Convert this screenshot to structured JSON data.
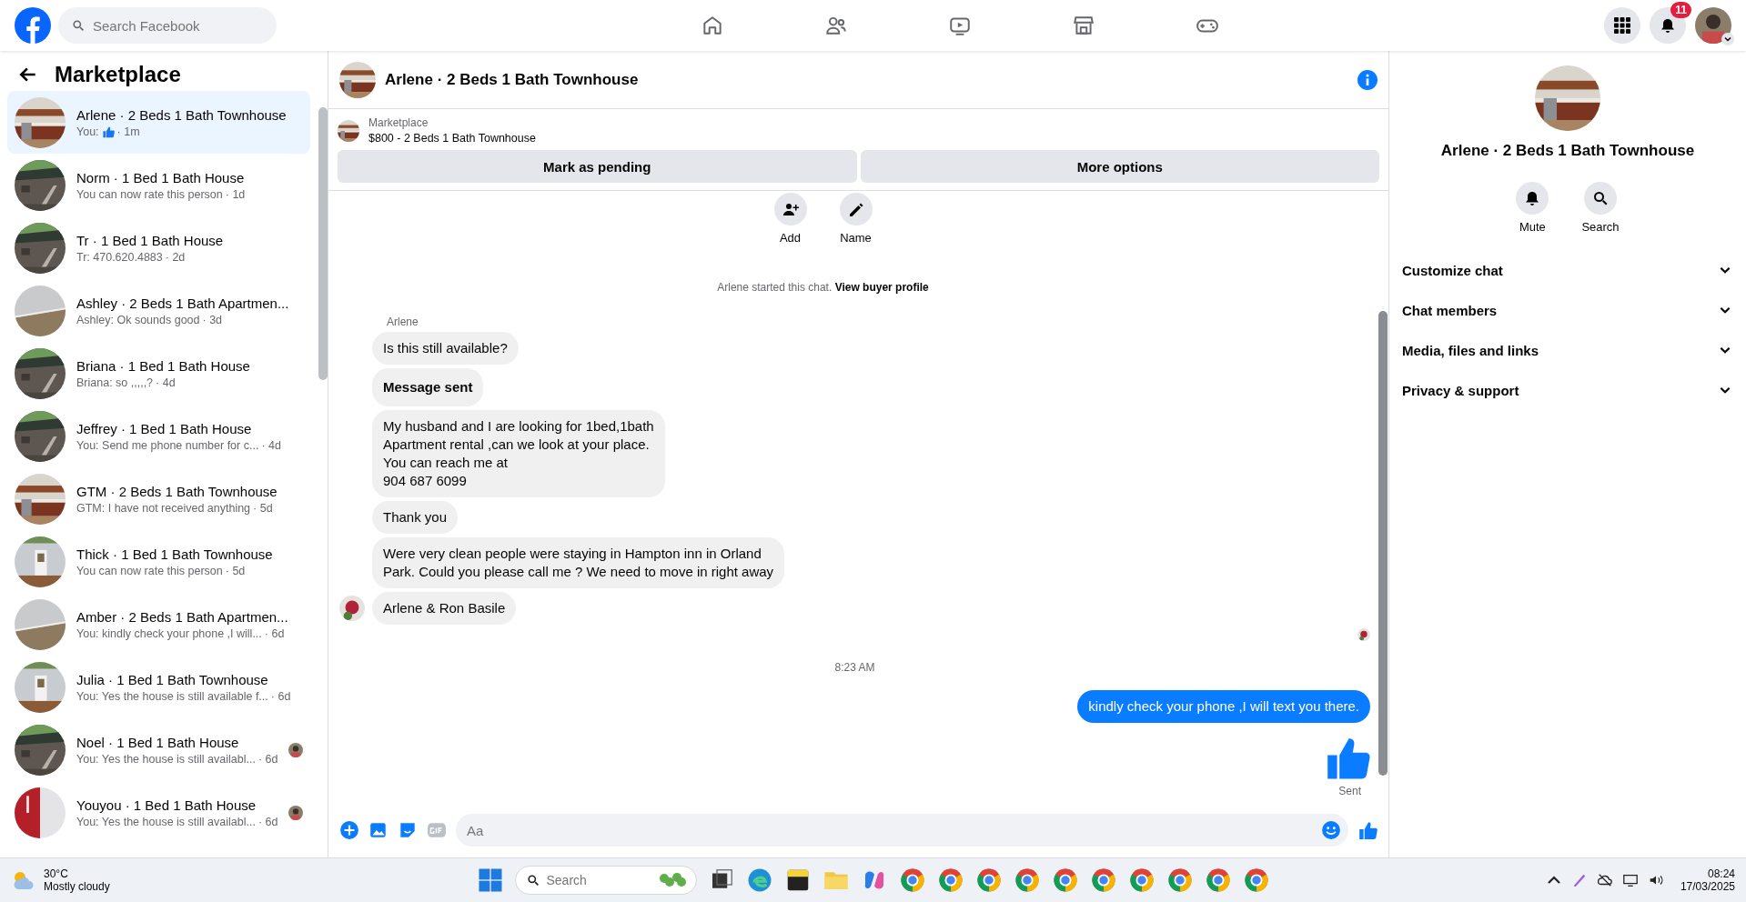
{
  "topbar": {
    "search": {
      "placeholder": "Search Facebook"
    },
    "notifications_badge": "11"
  },
  "sidebar": {
    "title": "Marketplace",
    "items": [
      {
        "title": "Arlene · 2 Beds 1 Bath Townhouse",
        "preview": "You:",
        "like_icon": true,
        "time": "· 1m",
        "seen_avatar": false,
        "selected": true
      },
      {
        "title": "Norm · 1 Bed 1 Bath House",
        "preview": "You can now rate this person",
        "like_icon": false,
        "time": "· 1d",
        "seen_avatar": false,
        "selected": false
      },
      {
        "title": "Tr · 1 Bed 1 Bath House",
        "preview": "Tr: 470.620.4883",
        "like_icon": false,
        "time": "· 2d",
        "seen_avatar": false,
        "selected": false
      },
      {
        "title": "Ashley · 2 Beds 1 Bath Apartmen...",
        "preview": "Ashley: Ok sounds good",
        "like_icon": false,
        "time": "· 3d",
        "seen_avatar": false,
        "selected": false
      },
      {
        "title": "Briana · 1 Bed 1 Bath House",
        "preview": "Briana: so ,,,,,?",
        "like_icon": false,
        "time": "· 4d",
        "seen_avatar": false,
        "selected": false
      },
      {
        "title": "Jeffrey · 1 Bed 1 Bath House",
        "preview": "You: Send me phone number for c...",
        "like_icon": false,
        "time": "· 4d",
        "seen_avatar": false,
        "selected": false
      },
      {
        "title": "GTM · 2 Beds 1 Bath Townhouse",
        "preview": "GTM: I have not received anything",
        "like_icon": false,
        "time": "· 5d",
        "seen_avatar": false,
        "selected": false
      },
      {
        "title": "Thick · 1 Bed 1 Bath Townhouse",
        "preview": "You can now rate this person",
        "like_icon": false,
        "time": "· 5d",
        "seen_avatar": false,
        "selected": false
      },
      {
        "title": "Amber · 2 Beds 1 Bath Apartmen...",
        "preview": "You: kindly check your phone ,I will...",
        "like_icon": false,
        "time": "· 6d",
        "seen_avatar": false,
        "selected": false
      },
      {
        "title": "Julia · 1 Bed 1 Bath Townhouse",
        "preview": "You: Yes the house is still available f...",
        "like_icon": false,
        "time": "· 6d",
        "seen_avatar": false,
        "selected": false
      },
      {
        "title": "Noel · 1 Bed 1 Bath House",
        "preview": "You: Yes the house is still availabl...",
        "like_icon": false,
        "time": "· 6d",
        "seen_avatar": true,
        "selected": false
      },
      {
        "title": "Youyou · 1 Bed 1 Bath House",
        "preview": "You: Yes the house is still availabl...",
        "like_icon": false,
        "time": "· 6d",
        "seen_avatar": true,
        "selected": false
      }
    ]
  },
  "chat": {
    "title": "Arlene · 2 Beds 1 Bath Townhouse",
    "listing": {
      "source": "Marketplace",
      "summary": "$800 - 2 Beds 1 Bath Townhouse"
    },
    "buttons": [
      "Mark as pending",
      "More options"
    ],
    "actions": [
      {
        "label": "Add",
        "kind": "add-person"
      },
      {
        "label": "Name",
        "kind": "pencil"
      }
    ],
    "started": {
      "text": "Arlene started this chat.",
      "link": "View buyer profile"
    },
    "sender": "Arlene",
    "incoming": [
      {
        "text": "Is this still available?",
        "bold": false,
        "avatar": false
      },
      {
        "text": "Message sent",
        "bold": true,
        "avatar": false
      },
      {
        "text": "My husband and I are looking for 1bed,1bath\nApartment rental ,can we look at your place.\nYou can reach me at\n904 687 6099",
        "bold": false,
        "avatar": false
      },
      {
        "text": "Thank you",
        "bold": false,
        "avatar": false
      },
      {
        "text": "Were very clean people were staying in Hampton inn in Orland\nPark. Could you please call me ? We need to move in right away",
        "bold": false,
        "avatar": false
      },
      {
        "text": "Arlene & Ron Basile",
        "bold": false,
        "avatar": true
      }
    ],
    "timestamp": "8:23 AM",
    "outgoing": [
      {
        "text": "kindly check your phone ,I will text you there."
      }
    ],
    "like": {
      "status": "Sent"
    },
    "composer": {
      "placeholder": "Aa"
    }
  },
  "info": {
    "title": "Arlene · 2 Beds 1 Bath Townhouse",
    "actions": [
      {
        "label": "Mute",
        "kind": "bell"
      },
      {
        "label": "Search",
        "kind": "search"
      }
    ],
    "sections": [
      "Customize chat",
      "Chat members",
      "Media, files and links",
      "Privacy & support"
    ]
  },
  "taskbar": {
    "weather": {
      "temp": "30°C",
      "condition": "Mostly cloudy"
    },
    "search": {
      "placeholder": "Search"
    },
    "time": "08:24",
    "date": "17/03/2025"
  }
}
